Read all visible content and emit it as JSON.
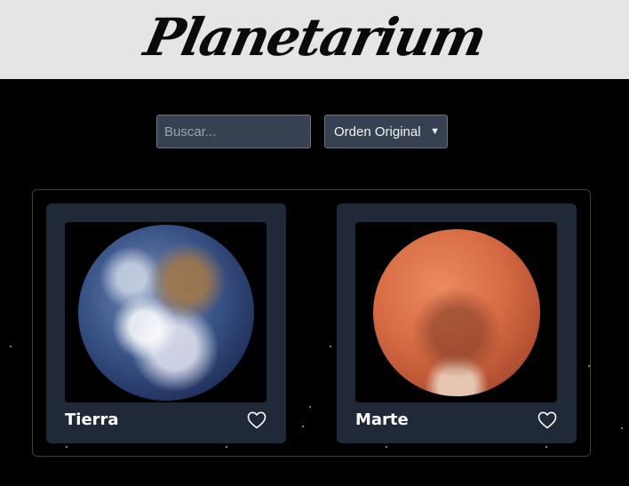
{
  "header": {
    "logo": "Planetarium"
  },
  "controls": {
    "search_placeholder": "Buscar...",
    "sort_selected": "Orden Original"
  },
  "cards": [
    {
      "name": "Tierra",
      "image": "earth-image",
      "favorite": false
    },
    {
      "name": "Marte",
      "image": "mars-image",
      "favorite": false
    }
  ],
  "colors": {
    "header_bg": "#e5e5e5",
    "page_bg": "#000000",
    "card_bg": "#1f2937",
    "input_bg": "#374151"
  }
}
